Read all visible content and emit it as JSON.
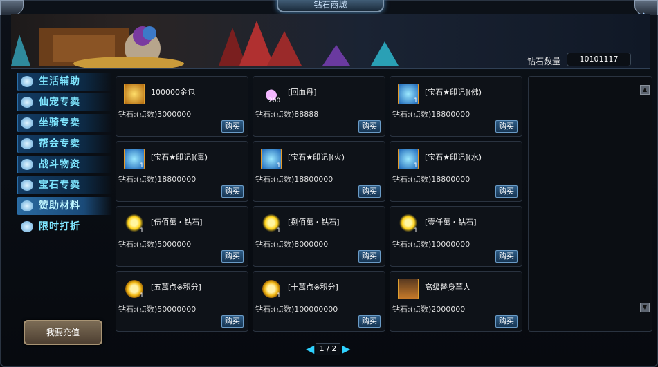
{
  "window": {
    "title": "钻石商城",
    "close_icon": "close-icon"
  },
  "header": {
    "diamond_label": "钻石数量",
    "diamond_value": "10101117"
  },
  "sidebar": {
    "items": [
      {
        "label": "生活辅助",
        "icon": "life-icon"
      },
      {
        "label": "仙宠专卖",
        "icon": "paw-icon"
      },
      {
        "label": "坐骑专卖",
        "icon": "mount-icon"
      },
      {
        "label": "帮会专卖",
        "icon": "guild-icon"
      },
      {
        "label": "战斗物资",
        "icon": "battle-icon"
      },
      {
        "label": "宝石专卖",
        "icon": "gem-icon"
      },
      {
        "label": "赞助材料",
        "icon": "sponsor-icon"
      },
      {
        "label": "限时打折",
        "icon": "horn-icon"
      }
    ],
    "active_index": 6,
    "recharge_label": "我要充值"
  },
  "items": [
    {
      "name": "100000金包",
      "price": "钻石:(点数)3000000",
      "count": "",
      "icon": "gold-bag"
    },
    {
      "name": "[回血丹]",
      "price": "钻石:(点数)88888",
      "count": "200",
      "icon": "pill"
    },
    {
      "name": "[宝石★印记](佛)",
      "price": "钻石:(点数)18800000",
      "count": "1",
      "icon": "snow"
    },
    {
      "name": "[宝石★印记](毒)",
      "price": "钻石:(点数)18800000",
      "count": "1",
      "icon": "snow"
    },
    {
      "name": "[宝石★印记](火)",
      "price": "钻石:(点数)18800000",
      "count": "1",
      "icon": "snow"
    },
    {
      "name": "[宝石★印记](水)",
      "price": "钻石:(点数)18800000",
      "count": "1",
      "icon": "snow"
    },
    {
      "name": "[伍佰萬・钻石]",
      "price": "钻石:(点数)5000000",
      "count": "1",
      "icon": "gem"
    },
    {
      "name": "[捌佰萬・钻石]",
      "price": "钻石:(点数)8000000",
      "count": "1",
      "icon": "gem"
    },
    {
      "name": "[壹仟萬・钻石]",
      "price": "钻石:(点数)10000000",
      "count": "1",
      "icon": "gem"
    },
    {
      "name": "[五萬点※积分]",
      "price": "钻石:(点数)50000000",
      "count": "1",
      "icon": "coin"
    },
    {
      "name": "[十萬点※积分]",
      "price": "钻石:(点数)100000000",
      "count": "1",
      "icon": "coin"
    },
    {
      "name": "高级替身草人",
      "price": "钻石:(点数)2000000",
      "count": "",
      "icon": "scarecrow"
    }
  ],
  "buy_label": "购买",
  "pager": {
    "page": "1 / 2"
  }
}
